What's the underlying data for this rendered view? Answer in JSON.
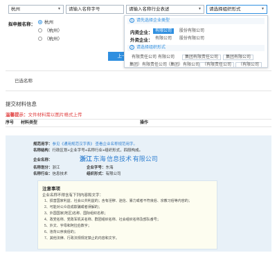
{
  "search": {
    "city": "杭州",
    "name_placeholder": "请输入名称字号",
    "industry_placeholder": "请输入名称行业表述",
    "org_placeholder": "请选择组织形式"
  },
  "apply_label": "拟申报名称：",
  "options": [
    "杭州",
    "（杭州）",
    "（杭州）"
  ],
  "selected_option": 0,
  "popup": {
    "step1": "请先选择企业类型",
    "domestic_label": "内资企业：",
    "domestic_items": [
      "有限公司",
      "股份有限公司"
    ],
    "foreign_label": "外资企业：",
    "foreign_items": [
      "有限公司",
      "股份有限公司"
    ],
    "step2": "请选择组织形式",
    "org_row1": [
      "有限责任公司",
      "有限公司",
      "集团有限责任公司",
      "集团有限公司"
    ],
    "org_row2": [
      "集团）有限责任公司",
      "（集团）有限公司",
      "（有限责任公司",
      "（有限公司"
    ],
    "selected_domestic": "有限公司"
  },
  "next_button": "上一",
  "selected_names": "已选名称",
  "submit_title": "提交材料信息",
  "warning_prefix": "温馨提示：",
  "warning_text": "文件材料需以图片格式上传",
  "table": {
    "col1": "序号",
    "col2": "材料类型",
    "col3": "操作"
  },
  "name_card": {
    "rule_label": "规范用字：",
    "rule_text": "参见《通用规范汉字表》 查看企业名称规范用字。",
    "structure_label": "名称结构：",
    "structure_text": "行政区划+企业字号+名称行业+组织形式，四段构成。",
    "name_label": "企业名称：",
    "name_region": "浙江",
    "name_brand": "东海",
    "name_industry": "信息技术",
    "name_org": "有限公司",
    "region_label": "名称划分：",
    "region_value": "浙江",
    "brand_label": "企业字号：",
    "brand_value": "东海",
    "industry_label": "名称行业：",
    "industry_value": "信息技术",
    "org_label": "组织形式：",
    "org_value": "有限公司"
  },
  "notice": {
    "title": "注意事项",
    "intro": "企业名称不得含有下列内容和文字：",
    "items": [
      "1、损害国家利益、社会公共利益的；含有淫秽、迷信、暴力或者不符良俗、宗教习俗等内容的；",
      "2、可能对公众造成欺骗或者误解的；",
      "3、外国国家(地区)名称、国际组织名称；",
      "4、政党名称、党政军机关名称、群团组织名称、社会组织名称及部队番号；",
      "5、外文、字母和阿拉伯数字；",
      "6、违背公序良俗的；",
      "7、其他法律、行政法规规定禁止的内容和文字。"
    ]
  }
}
